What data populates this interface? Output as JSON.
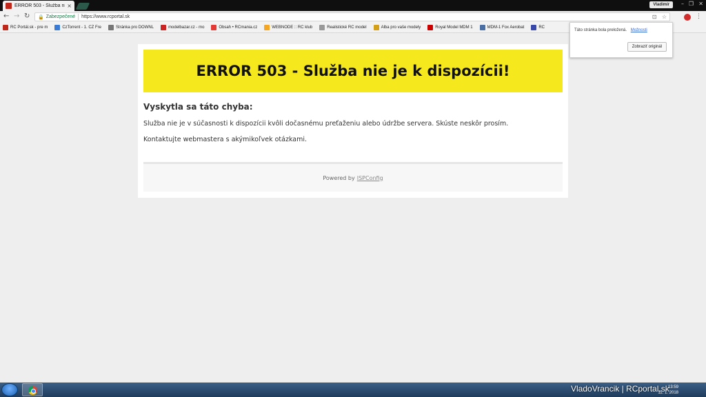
{
  "browser": {
    "tab_title": "ERROR 503 - Služba nie je",
    "tab_close": "×",
    "profile_name": "Vladimír",
    "secure_label": "Zabezpečené",
    "url": "https://www.rcportal.sk",
    "bookmarks": [
      {
        "label": "RC Portál.sk - pre m",
        "color": "#c0281c"
      },
      {
        "label": "CzTorrent - 1. CZ Fre",
        "color": "#3a7bd5"
      },
      {
        "label": "Stránka pro DOWNL",
        "color": "#777777"
      },
      {
        "label": "modelbazar.cz - mo",
        "color": "#cc2222"
      },
      {
        "label": "Obsah • RCmania.cz",
        "color": "#e53935"
      },
      {
        "label": "WEBNODE :: RC klub",
        "color": "#f5a623"
      },
      {
        "label": "Realistické RC model",
        "color": "#999999"
      },
      {
        "label": "Alba pro vaše modely",
        "color": "#d4a017"
      },
      {
        "label": "Royal Model MDM 1",
        "color": "#cc0000"
      },
      {
        "label": "MDM-1 Fox Aerobat",
        "color": "#4a6fa5"
      },
      {
        "label": "RC",
        "color": "#3949ab"
      }
    ]
  },
  "popup": {
    "message": "Táto stránka bola preložená.",
    "options_link": "Možnosti",
    "show_original_button": "Zobraziť originál"
  },
  "page": {
    "banner_title": "ERROR 503 - Služba nie je k dispozícii!",
    "subheading": "Vyskytla sa táto chyba:",
    "paragraph_1": "Služba nie je v súčasnosti k dispozícii kvôli dočasnému preťaženiu alebo údržbe servera. Skúste neskôr prosím.",
    "paragraph_2": "Kontaktujte webmastera s akýmikoľvek otázkami.",
    "footer_prefix": "Powered by",
    "footer_link": "ISPConfig"
  },
  "taskbar": {
    "watermark": "VladoVrancik | RCportal.sk",
    "time": "13:59",
    "date": "11. 1. 2018"
  },
  "colors": {
    "banner": "#f5e91d",
    "secure_green": "#0b8043"
  }
}
